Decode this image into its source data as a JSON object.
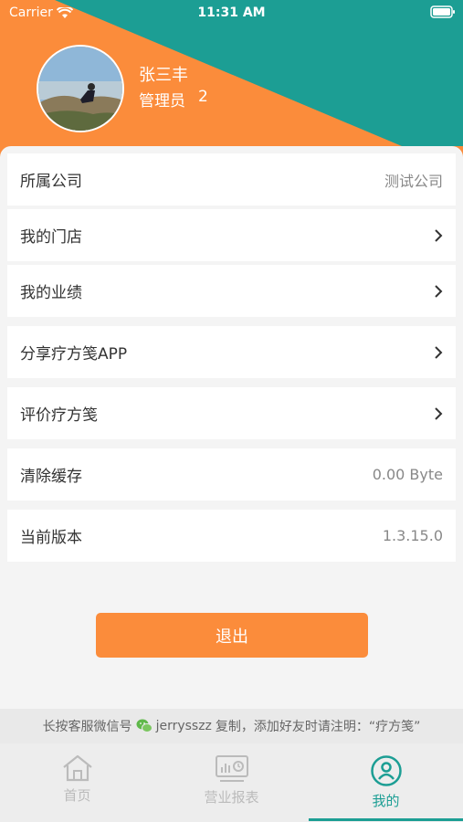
{
  "status_bar": {
    "carrier": "Carrier",
    "time": "11:31 AM"
  },
  "profile": {
    "name": "张三丰",
    "role": "管理员",
    "level": "2"
  },
  "menu": [
    {
      "label": "所属公司",
      "value": "测试公司"
    },
    {
      "label": "我的门店",
      "value": ""
    },
    {
      "label": "我的业绩",
      "value": ""
    },
    {
      "label": "分享疗方笺APP",
      "value": ""
    },
    {
      "label": "评价疗方笺",
      "value": ""
    },
    {
      "label": "清除缓存",
      "value": "0.00 Byte"
    },
    {
      "label": "当前版本",
      "value": "1.3.15.0"
    }
  ],
  "logout_label": "退出",
  "notice": {
    "prefix": "长按客服微信号",
    "wechat_id": "jerrysszz",
    "suffix": "复制，添加好友时请注明：“疗方笺”"
  },
  "tabs": [
    {
      "label": "首页",
      "icon": "home-icon"
    },
    {
      "label": "营业报表",
      "icon": "report-icon"
    },
    {
      "label": "我的",
      "icon": "profile-icon"
    }
  ],
  "colors": {
    "teal": "#1c9e94",
    "orange": "#fb8c3b"
  }
}
